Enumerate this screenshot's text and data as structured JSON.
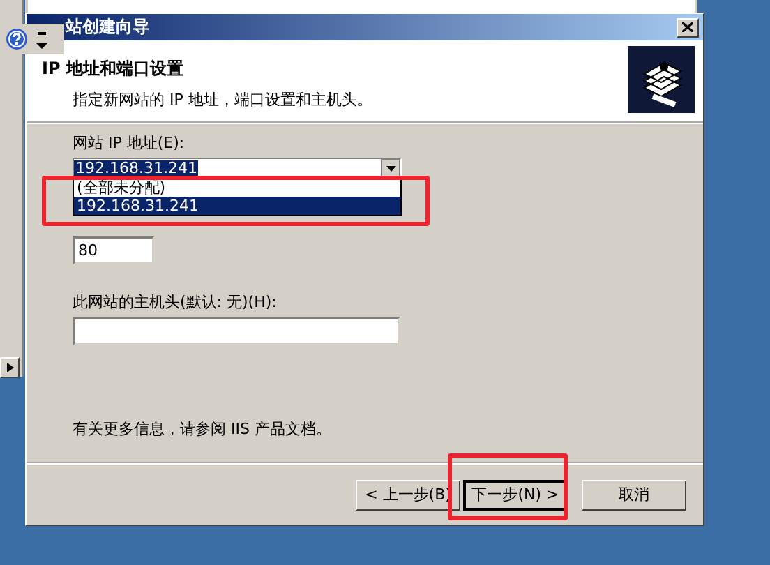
{
  "window": {
    "title": "站创建向导"
  },
  "header": {
    "title": "IP 地址和端口设置",
    "subtitle": "指定新网站的 IP 地址，端口设置和主机头。"
  },
  "ip_address": {
    "label": "网站 IP 地址(E):",
    "value": "192.168.31.241",
    "dropdown": {
      "expanded": true,
      "highlighted": true,
      "options": [
        {
          "label": "(全部未分配)",
          "selected": false
        },
        {
          "label": "192.168.31.241",
          "selected": true
        }
      ]
    }
  },
  "tcp_port": {
    "value": "80"
  },
  "host_header": {
    "label": "此网站的主机头(默认: 无)(H):"
  },
  "info": "有关更多信息，请参阅 IIS 产品文档。",
  "buttons": [
    {
      "label": "< 上一步(B)",
      "default": false,
      "highlighted": false
    },
    {
      "label": "下一步(N) >",
      "default": true,
      "highlighted": true
    },
    {
      "label": "取消",
      "default": false,
      "highlighted": false
    }
  ]
}
